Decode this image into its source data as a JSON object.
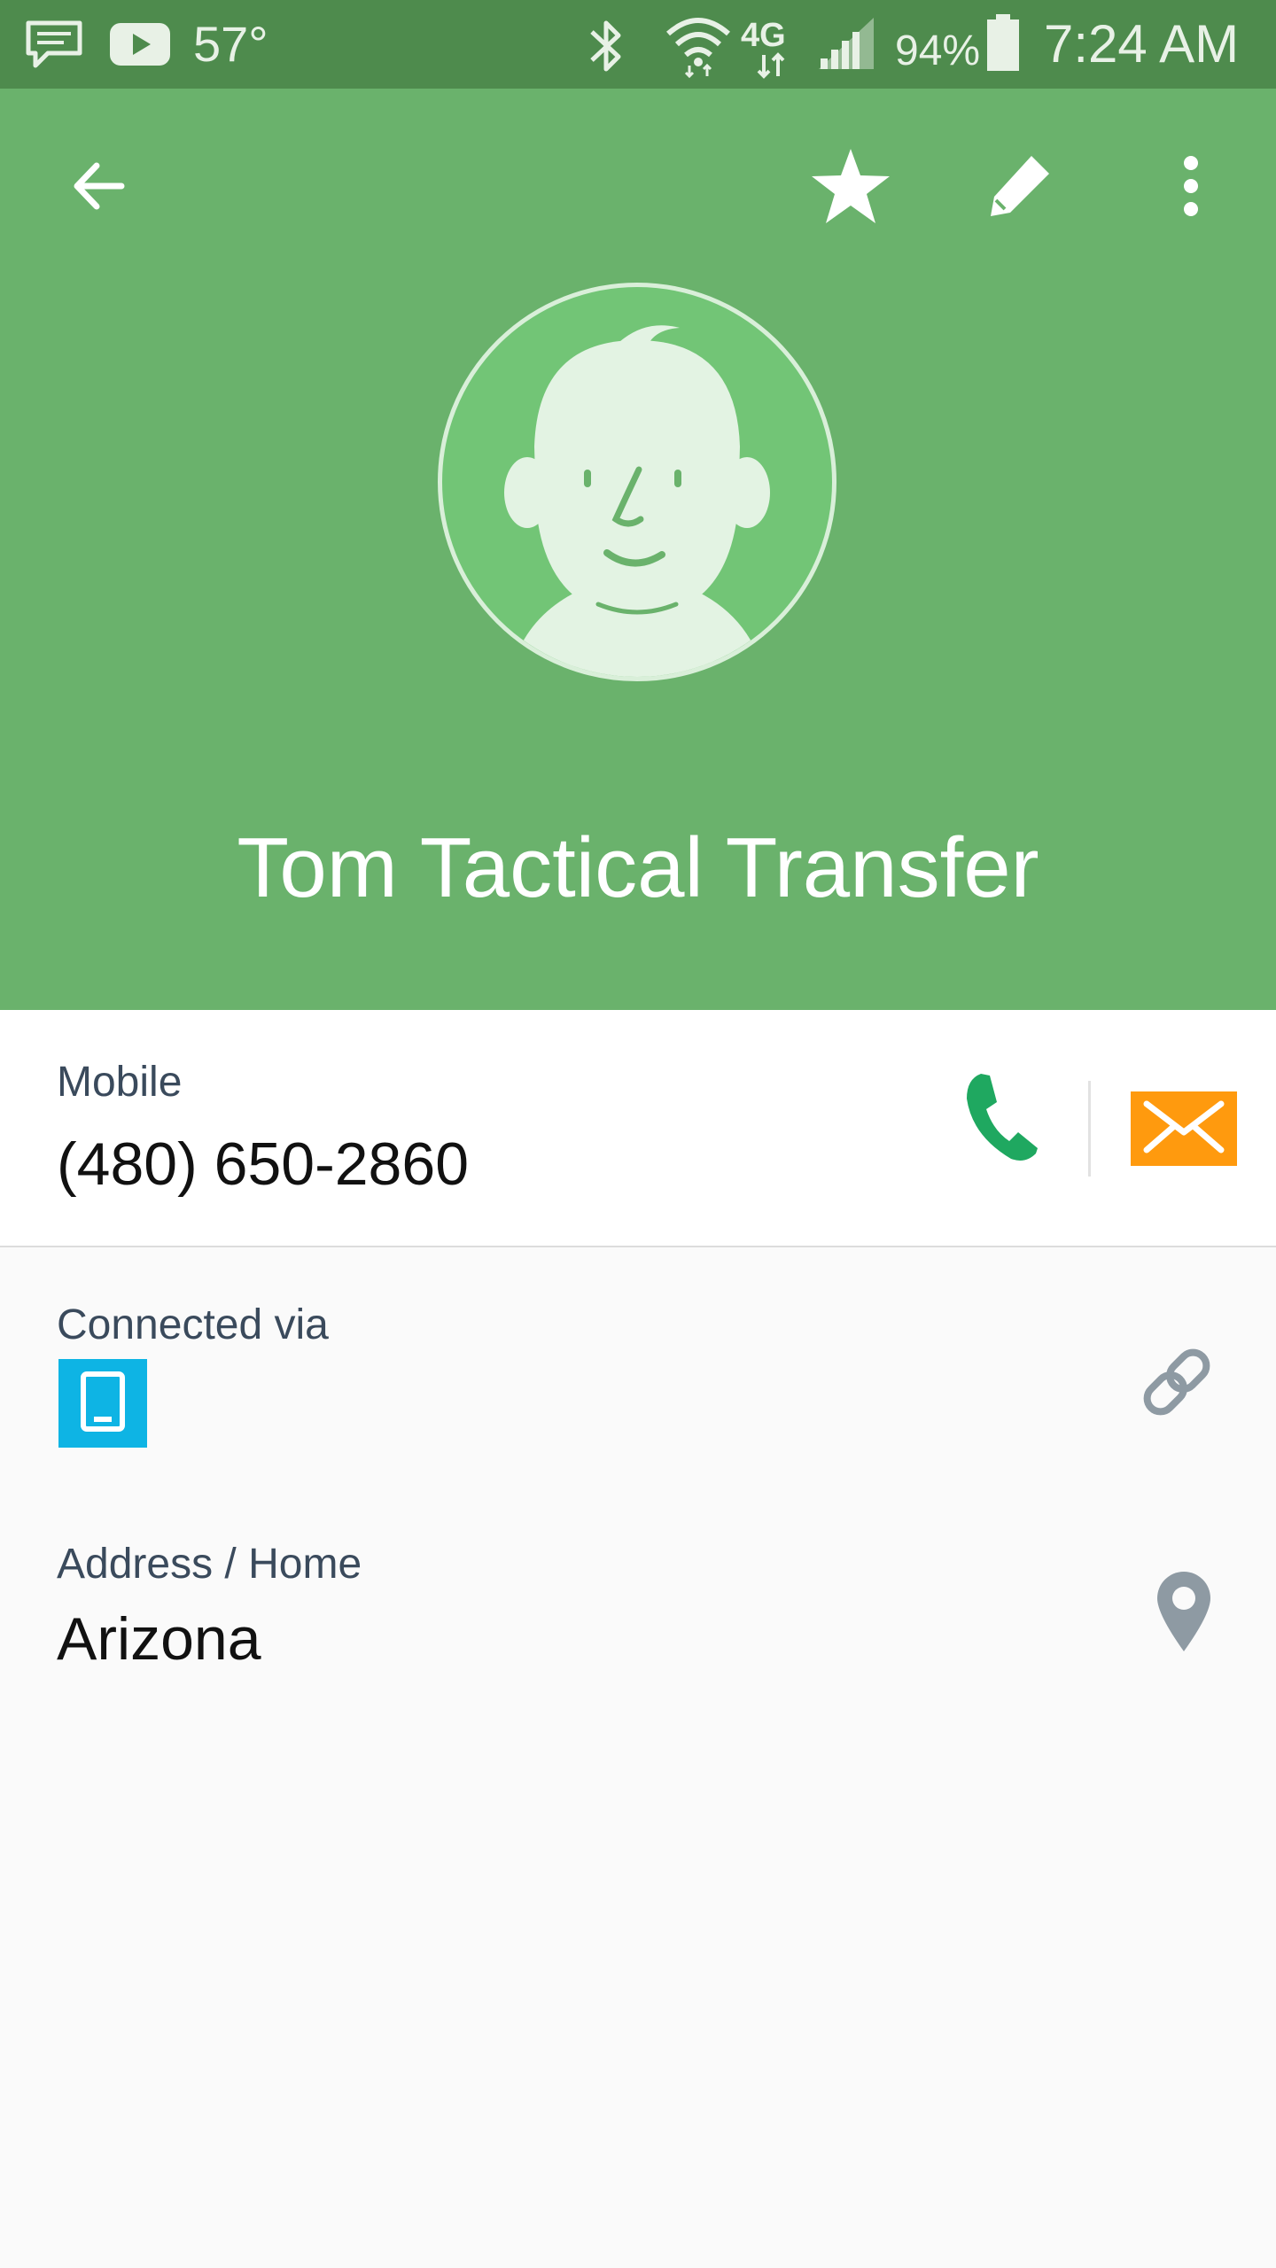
{
  "status_bar": {
    "temperature": "57°",
    "battery_percent": "94%",
    "time": "7:24 AM",
    "network_label": "4G",
    "icons": [
      "message-icon",
      "youtube-icon",
      "bluetooth-icon",
      "wifi-icon",
      "lte-icon",
      "signal-icon",
      "battery-icon"
    ]
  },
  "toolbar": {
    "icons": [
      "back-arrow-icon",
      "star-icon",
      "edit-icon",
      "more-vert-icon"
    ]
  },
  "contact": {
    "name": "Tom Tactical Transfer",
    "avatar_icon": "default-avatar-icon"
  },
  "phone": {
    "label": "Mobile",
    "number": "(480) 650-2860",
    "call_icon": "phone-icon",
    "message_icon": "message-envelope-icon"
  },
  "connected": {
    "label": "Connected via",
    "device_icon": "device-icon",
    "link_icon": "link-icon"
  },
  "address": {
    "label": "Address / Home",
    "value": "Arizona",
    "location_icon": "location-pin-icon"
  },
  "colors": {
    "status_bar": "#4e8b4d",
    "header": "#6ab26c",
    "avatar_bg": "#72c576",
    "call_green": "#1fa860",
    "message_orange": "#ff9a0e",
    "device_blue": "#0eb4e4",
    "label_text": "#3a4a5c"
  }
}
